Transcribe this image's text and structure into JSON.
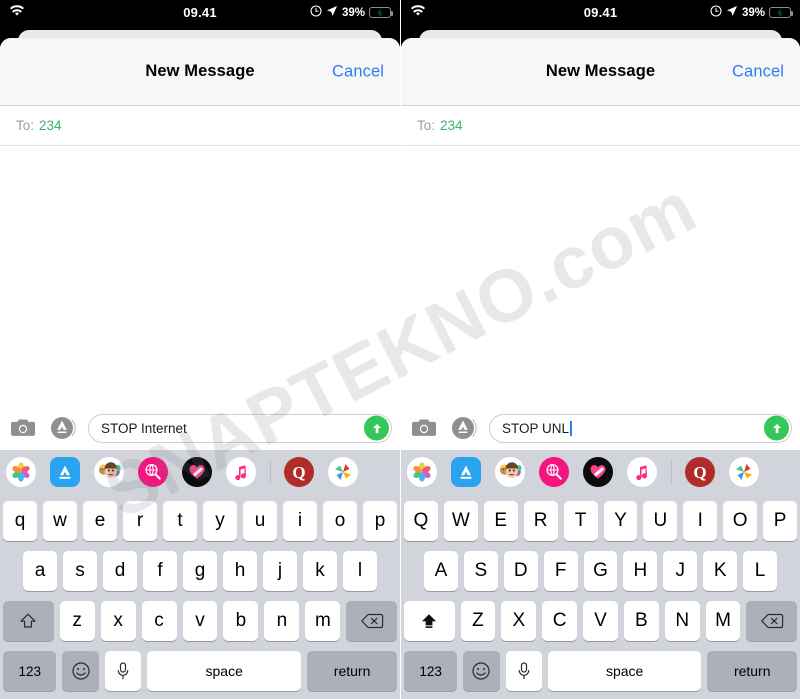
{
  "watermark": {
    "text": "SNAPTEKNO.com"
  },
  "status_bar": {
    "time": "09.41",
    "battery_percent": "39%",
    "icons": [
      "wifi-icon",
      "alarm-icon",
      "location-arrow-icon",
      "battery-charging-icon"
    ],
    "battery_color": "#35c759"
  },
  "navbar": {
    "title": "New Message",
    "cancel_label": "Cancel",
    "cancel_color": "#2f7cf6"
  },
  "recipient": {
    "label": "To:",
    "value": "234",
    "value_color": "#3cb46e"
  },
  "app_strip": {
    "icons": [
      {
        "name": "photos-icon"
      },
      {
        "name": "app-store-icon"
      },
      {
        "name": "memoji-icon"
      },
      {
        "name": "image-search-icon"
      },
      {
        "name": "digital-touch-icon"
      },
      {
        "name": "apple-music-icon"
      },
      {
        "name": "quora-icon"
      },
      {
        "name": "pinwheel-icon"
      }
    ]
  },
  "panels": [
    {
      "id": "left",
      "message_text": "STOP Internet",
      "caret_visible": false,
      "shift_state": "off",
      "keyboard": {
        "row1": [
          "q",
          "w",
          "e",
          "r",
          "t",
          "y",
          "u",
          "i",
          "o",
          "p"
        ],
        "row2": [
          "a",
          "s",
          "d",
          "f",
          "g",
          "h",
          "j",
          "k",
          "l"
        ],
        "row3": [
          "z",
          "x",
          "c",
          "v",
          "b",
          "n",
          "m"
        ],
        "space_label": "space",
        "return_label": "return",
        "numeric_label": "123"
      }
    },
    {
      "id": "right",
      "message_text": "STOP UNL",
      "caret_visible": true,
      "shift_state": "locked",
      "keyboard": {
        "row1": [
          "Q",
          "W",
          "E",
          "R",
          "T",
          "Y",
          "U",
          "I",
          "O",
          "P"
        ],
        "row2": [
          "A",
          "S",
          "D",
          "F",
          "G",
          "H",
          "J",
          "K",
          "L"
        ],
        "row3": [
          "Z",
          "X",
          "C",
          "V",
          "B",
          "N",
          "M"
        ],
        "space_label": "space",
        "return_label": "return",
        "numeric_label": "123"
      }
    }
  ],
  "input_bar": {
    "camera_icon": "camera-icon",
    "apps_icon": "app-store-icon",
    "send_icon": "send-arrow-icon",
    "send_color": "#35c759"
  }
}
